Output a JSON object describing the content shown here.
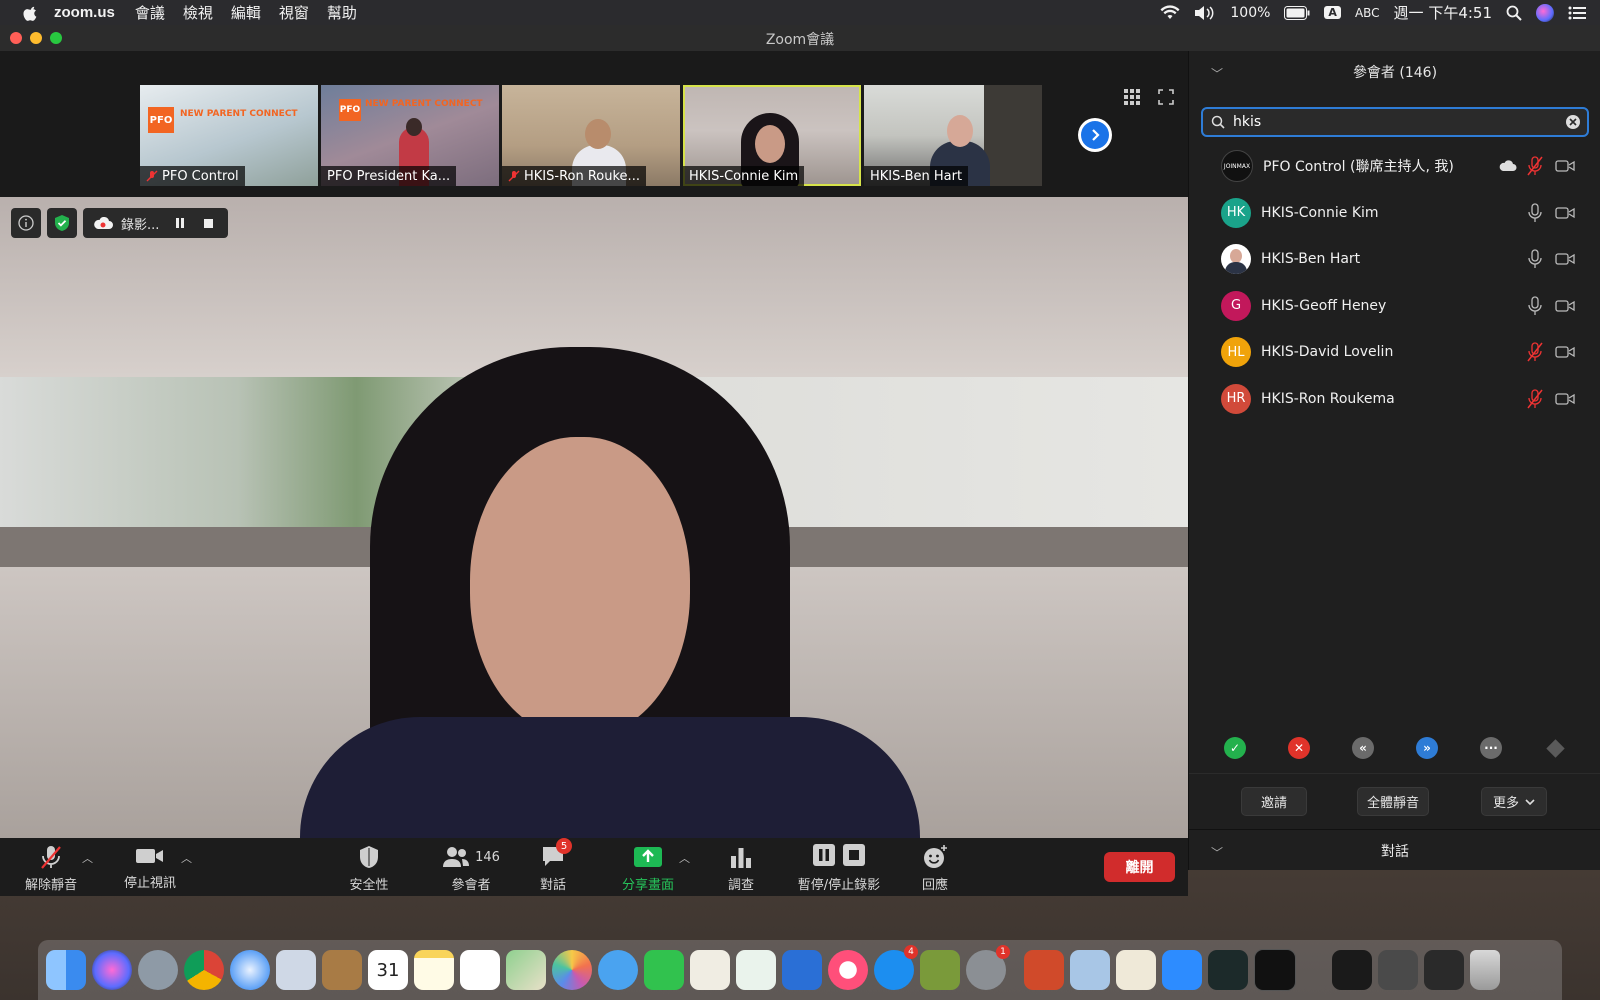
{
  "menubar": {
    "app": "zoom.us",
    "menus": [
      "會議",
      "檢視",
      "編輯",
      "視窗",
      "幫助"
    ],
    "battery": "100%",
    "input_source": "ABC",
    "clock": "週一 下午4:51"
  },
  "window": {
    "title": "Zoom會議"
  },
  "thumbnails": [
    {
      "name": "PFO Control",
      "muted": true,
      "slide_title": "NEW PARENT CONNECT"
    },
    {
      "name": "PFO President Ka...",
      "muted": false,
      "slide_title": "NEW PARENT CONNECT"
    },
    {
      "name": "HKIS-Ron Rouke...",
      "muted": true
    },
    {
      "name": "HKIS-Connie Kim",
      "muted": false,
      "active": true
    },
    {
      "name": "HKIS-Ben Hart",
      "muted": false
    }
  ],
  "recording": {
    "label": "錄影..."
  },
  "toolbar": {
    "unmute": "解除靜音",
    "stop_video": "停止視訊",
    "security": "安全性",
    "participants": "參會者",
    "participant_count": "146",
    "chat": "對話",
    "chat_badge": "5",
    "share": "分享畫面",
    "polls": "調查",
    "record": "暫停/停止錄影",
    "reactions": "回應",
    "leave": "離開"
  },
  "panel": {
    "title": "參會者 (146)",
    "search_value": "hkis",
    "participants": [
      {
        "name": "PFO Control (聯席主持人, 我)",
        "initials": "",
        "color": "#111111",
        "mic": "muted"
      },
      {
        "name": "HKIS-Connie Kim",
        "initials": "HK",
        "color": "#1aa38a",
        "mic": "on"
      },
      {
        "name": "HKIS-Ben Hart",
        "initials": "",
        "color": "#ffffff",
        "mic": "on"
      },
      {
        "name": "HKIS-Geoff Heney",
        "initials": "G",
        "color": "#c2185b",
        "mic": "on"
      },
      {
        "name": "HKIS-David Lovelin",
        "initials": "HL",
        "color": "#f0a30a",
        "mic": "muted"
      },
      {
        "name": "HKIS-Ron Roukema",
        "initials": "HR",
        "color": "#d14a3a",
        "mic": "muted"
      }
    ],
    "invite": "邀請",
    "mute_all": "全體靜音",
    "more": "更多",
    "chat": "對話"
  },
  "colors": {
    "accent": "#2e7cd6",
    "leave": "#d12c2c",
    "share": "#1db954",
    "active_border": "#d6e34a"
  }
}
